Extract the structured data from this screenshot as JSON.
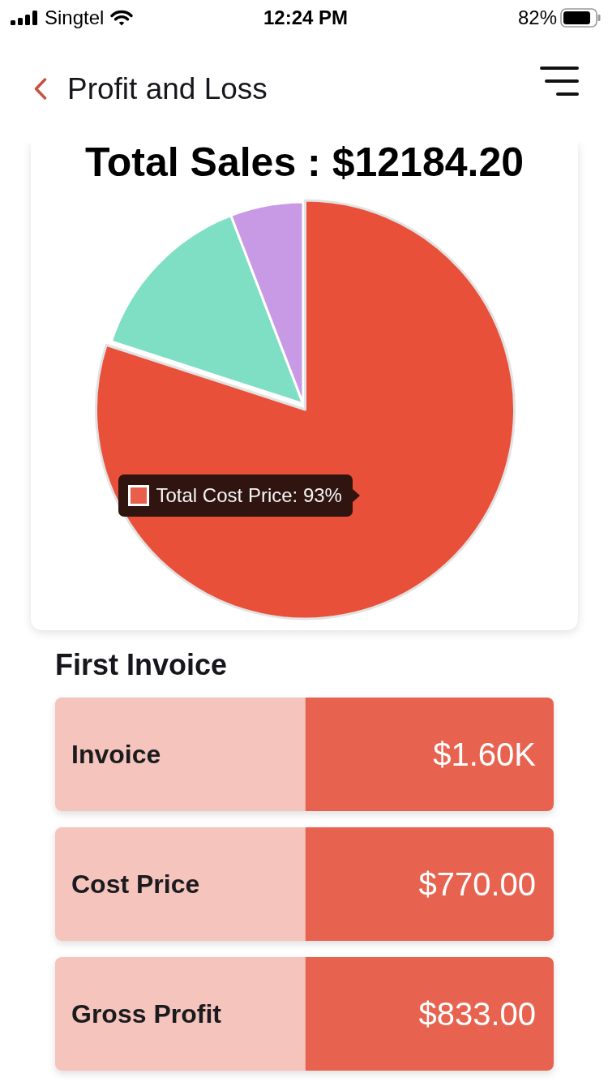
{
  "status_bar": {
    "carrier": "Singtel",
    "time": "12:24 PM",
    "battery_percent": "82%"
  },
  "header": {
    "title": "Profit and Loss"
  },
  "sales_card": {
    "title": "Total Sales : $12184.20",
    "tooltip": "Total Cost Price: 93%"
  },
  "first_invoice": {
    "title": "First Invoice",
    "rows": [
      {
        "label": "Invoice",
        "value": "$1.60K"
      },
      {
        "label": "Cost Price",
        "value": "$770.00"
      },
      {
        "label": "Gross Profit",
        "value": "$833.00"
      }
    ]
  }
}
